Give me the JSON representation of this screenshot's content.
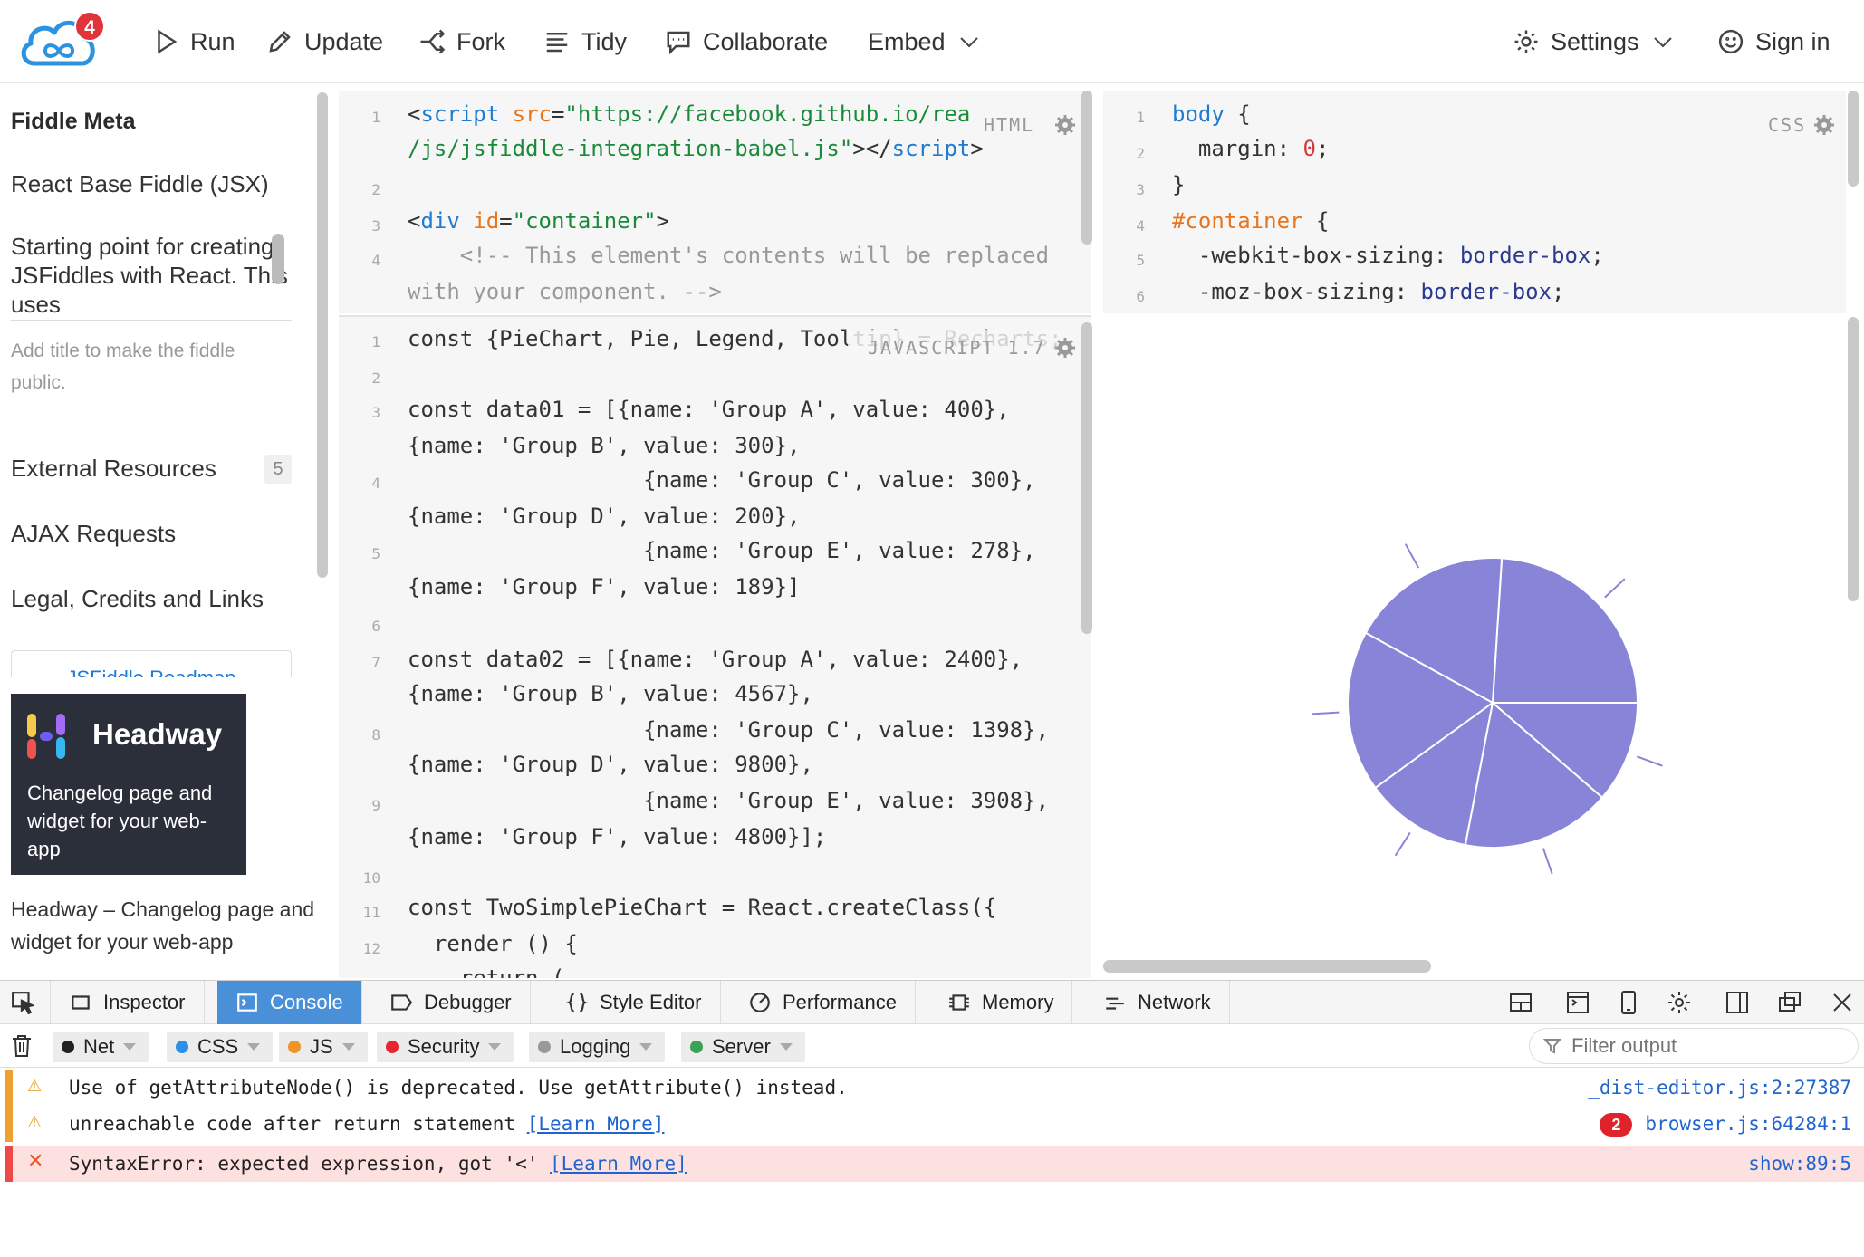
{
  "toolbar": {
    "notification_count": "4",
    "run": "Run",
    "update": "Update",
    "fork": "Fork",
    "tidy": "Tidy",
    "collaborate": "Collaborate",
    "embed": "Embed",
    "settings": "Settings",
    "sign_in": "Sign in"
  },
  "sidebar": {
    "title": "Fiddle Meta",
    "fiddle_name": "React Base Fiddle (JSX)",
    "description": "Starting point for creating JSFiddles with React. This uses",
    "hint": "Add title to make the fiddle public.",
    "external_resources": "External Resources",
    "external_count": "5",
    "ajax": "AJAX Requests",
    "legal": "Legal, Credits and Links",
    "roadmap": "JSFiddle Roadmap",
    "ad_brand": "Headway",
    "ad_text": "Changelog page and widget for your web-app",
    "ad_caption": "Headway – Changelog page and widget for your web-app"
  },
  "html_panel": {
    "label": "HTML",
    "line_numbers": [
      "1",
      "2",
      "3",
      "4"
    ],
    "l1a_open": "<",
    "l1a_tag": "script",
    "l1a_attr": "src",
    "l1a_eq": "=",
    "l1a_str": "\"https://facebook.github.io/react",
    "l1b_str": "/js/jsfiddle-integration-babel.js\"",
    "l1b_close": "></",
    "l1b_tag": "script",
    "l1b_end": ">",
    "l3_open": "<",
    "l3_tag": "div",
    "l3_attr": "id",
    "l3_eq": "=",
    "l3_str": "\"container\"",
    "l3_end": ">",
    "l4a": "    <!-- This element's contents will be replaced",
    "l4b": "with your component. -->"
  },
  "css_panel": {
    "label": "CSS",
    "line_numbers": [
      "1",
      "2",
      "3",
      "4",
      "5",
      "6"
    ],
    "l1_sel": "body",
    "l1_rest": " {",
    "l2_prop": "  margin: ",
    "l2_num": "0",
    "l2_end": ";",
    "l3": "}",
    "l4_sel": "#container",
    "l4_rest": " {",
    "l5_prop": "  -webkit-box-sizing: ",
    "l5_val": "border-box",
    "l5_end": ";",
    "l6_prop": "  -moz-box-sizing: ",
    "l6_val": "border-box",
    "l6_end": ";"
  },
  "js_panel": {
    "label": "JAVASCRIPT 1.7",
    "line_numbers": [
      "1",
      "2",
      "3",
      "4",
      "5",
      "6",
      "7",
      "8",
      "9",
      "10",
      "11",
      "12"
    ],
    "l1": "const {PieChart, Pie, Legend, Tooltip} = Recharts;",
    "l3a": "const data01 = [{name: 'Group A', value: 400},",
    "l3b": "{name: 'Group B', value: 300},",
    "l4a": "                  {name: 'Group C', value: 300},",
    "l4b": "{name: 'Group D', value: 200},",
    "l5a": "                  {name: 'Group E', value: 278},",
    "l5b": "{name: 'Group F', value: 189}]",
    "l7a": "const data02 = [{name: 'Group A', value: 2400},",
    "l7b": "{name: 'Group B', value: 4567},",
    "l8a": "                  {name: 'Group C', value: 1398},",
    "l8b": "{name: 'Group D', value: 9800},",
    "l9a": "                  {name: 'Group E', value: 3908},",
    "l9b": "{name: 'Group F', value: 4800}];",
    "l11": "const TwoSimplePieChart = React.createClass({",
    "l12": "  render () {",
    "l13": "    return ("
  },
  "result": {
    "pie_values": [
      400,
      300,
      300,
      200,
      278,
      189
    ],
    "pie_color": "#8884d8"
  },
  "devtools": {
    "tabs": {
      "inspector": "Inspector",
      "console": "Console",
      "debugger": "Debugger",
      "style_editor": "Style Editor",
      "performance": "Performance",
      "memory": "Memory",
      "network": "Network"
    },
    "filters": {
      "net": "Net",
      "css": "CSS",
      "js": "JS",
      "security": "Security",
      "logging": "Logging",
      "server": "Server"
    },
    "filter_placeholder": "Filter output",
    "messages": [
      {
        "text": "Use of getAttributeNode() is deprecated. Use getAttribute() instead.",
        "source": "_dist-editor.js:2:27387"
      },
      {
        "text": "unreachable code after return statement ",
        "link": "[Learn More]",
        "repeat": "2",
        "source": "browser.js:64284:1"
      },
      {
        "text": "SyntaxError: expected expression, got '<' ",
        "link": "[Learn More]",
        "source": "show:89:5"
      }
    ]
  }
}
